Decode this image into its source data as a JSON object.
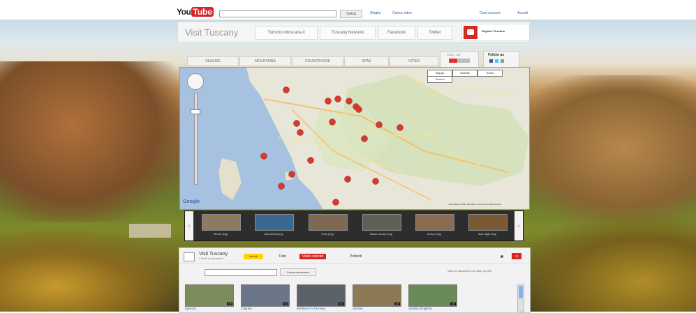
{
  "youtube": {
    "logo_you": "You",
    "logo_tube": "Tube",
    "search_placeholder": "",
    "search_button": "Cerca",
    "links": [
      "Sfoglia",
      "Carica video"
    ],
    "account_links": [
      "Crea account",
      "Accedi"
    ]
  },
  "channel": {
    "title": "Visit Tuscany",
    "links": [
      "Turismo.intoscana.it",
      "Tuscany Network",
      "Facebook",
      "Twitter"
    ],
    "region_logo_text": "Regione Toscana"
  },
  "map_tabs": [
    "SEASIDE",
    "MOUNTAINS",
    "COUNTRYSIDE",
    "SPAS",
    "CITIES"
  ],
  "language": {
    "label": "ENG - ITA"
  },
  "follow": {
    "label": "Follow us"
  },
  "map": {
    "types": [
      "Mappa",
      "Satellite",
      "Ibrida",
      "Terreno"
    ],
    "google": "Google",
    "credit": "Dati mappa ©2011 Tele Atlas - Termini e condizioni d'uso"
  },
  "carousel": {
    "prev": "‹",
    "next": "›",
    "items": [
      {
        "caption": "Firenze (eng)",
        "color": "#8d7a63"
      },
      {
        "caption": "Isola d'Elba (eng)",
        "color": "#3b6890"
      },
      {
        "caption": "Prato (eng)",
        "color": "#7e6a52"
      },
      {
        "caption": "Massa Carrara (eng)",
        "color": "#5f6158"
      },
      {
        "caption": "Arezzo (eng)",
        "color": "#8b6c50"
      },
      {
        "caption": "Isola Giglio (eng)",
        "color": "#7a5a35"
      }
    ]
  },
  "channel_panel": {
    "title": "Visit Tuscany",
    "subtitle": "7 iscritti ai caricamenti",
    "subscribe": "Iscriviti",
    "tabs": [
      "Tutto",
      "Video caricati",
      "Preferiti"
    ],
    "search_button": "Cerca caricamenti",
    "stats": "Video 41 caricamenti | per data | più visti",
    "videos": [
      {
        "title": "Igiesola",
        "duration": "2:45",
        "color": "#7c8b5a"
      },
      {
        "title": "Capraia",
        "duration": "3:10",
        "color": "#6a7687"
      },
      {
        "title": "Wellness in Tuscany",
        "duration": "3:34",
        "color": "#5a6369"
      },
      {
        "title": "Versilia",
        "duration": "2:28",
        "color": "#8b7a55"
      },
      {
        "title": "Versilia (English)",
        "duration": "2:28",
        "color": "#6a8a58"
      }
    ]
  }
}
